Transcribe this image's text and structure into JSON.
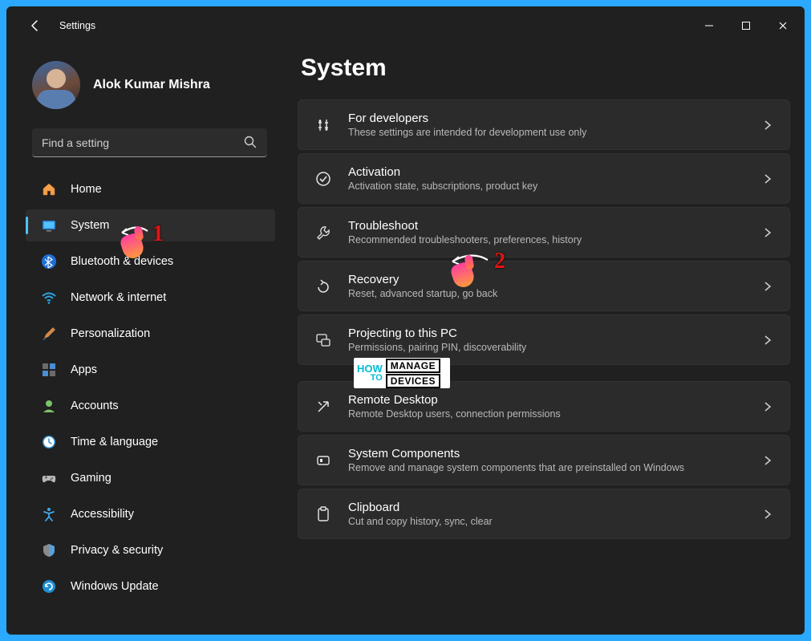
{
  "window": {
    "title": "Settings"
  },
  "profile": {
    "name": "Alok Kumar Mishra"
  },
  "search": {
    "placeholder": "Find a setting"
  },
  "nav": {
    "items": [
      {
        "id": "home",
        "label": "Home"
      },
      {
        "id": "system",
        "label": "System",
        "active": true
      },
      {
        "id": "bluetooth",
        "label": "Bluetooth & devices"
      },
      {
        "id": "network",
        "label": "Network & internet"
      },
      {
        "id": "personalization",
        "label": "Personalization"
      },
      {
        "id": "apps",
        "label": "Apps"
      },
      {
        "id": "accounts",
        "label": "Accounts"
      },
      {
        "id": "time",
        "label": "Time & language"
      },
      {
        "id": "gaming",
        "label": "Gaming"
      },
      {
        "id": "accessibility",
        "label": "Accessibility"
      },
      {
        "id": "privacy",
        "label": "Privacy & security"
      },
      {
        "id": "update",
        "label": "Windows Update"
      }
    ]
  },
  "page": {
    "title": "System"
  },
  "cards": [
    {
      "id": "dev",
      "title": "For developers",
      "subtitle": "These settings are intended for development use only"
    },
    {
      "id": "activation",
      "title": "Activation",
      "subtitle": "Activation state, subscriptions, product key"
    },
    {
      "id": "troubleshoot",
      "title": "Troubleshoot",
      "subtitle": "Recommended troubleshooters, preferences, history"
    },
    {
      "id": "recovery",
      "title": "Recovery",
      "subtitle": "Reset, advanced startup, go back"
    },
    {
      "id": "projecting",
      "title": "Projecting to this PC",
      "subtitle": "Permissions, pairing PIN, discoverability"
    },
    {
      "id": "remote",
      "title": "Remote Desktop",
      "subtitle": "Remote Desktop users, connection permissions"
    },
    {
      "id": "components",
      "title": "System Components",
      "subtitle": "Remove and manage system components that are preinstalled on Windows"
    },
    {
      "id": "clipboard",
      "title": "Clipboard",
      "subtitle": "Cut and copy history, sync, clear"
    }
  ],
  "annotations": {
    "step1": "1",
    "step2": "2"
  },
  "watermark": {
    "line1a": "HOW",
    "line1b": "TO",
    "box1": "MANAGE",
    "box2": "DEVICES"
  }
}
